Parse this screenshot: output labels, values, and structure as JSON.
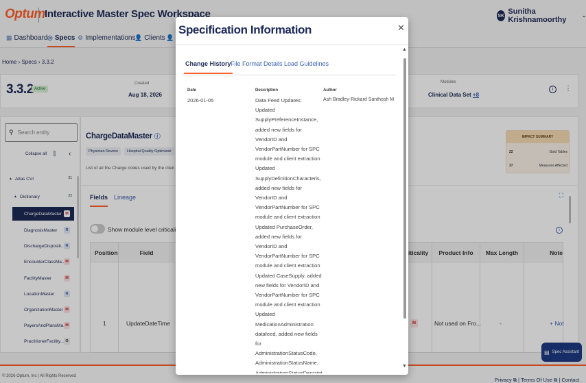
{
  "header": {
    "logo": "Optum",
    "app_title": "Interactive Master Spec Workspace",
    "user_initials": "SK",
    "user_name": "Sunitha Krishnamoorthy"
  },
  "nav": {
    "items": [
      {
        "label": "Dashboard",
        "icon": "dashboard-icon"
      },
      {
        "label": "Specs",
        "icon": "globe-icon"
      },
      {
        "label": "Implementations",
        "icon": "gear-icon"
      },
      {
        "label": "Clients",
        "icon": "person-icon"
      },
      {
        "label": "1",
        "icon": "person-icon"
      }
    ],
    "active": "Specs"
  },
  "breadcrumb": {
    "home": "Home",
    "specs": "Specs",
    "current": "3.3.2"
  },
  "spec": {
    "version": "3.3.2",
    "status": "Active",
    "created_label": "Created",
    "created_value": "Aug 18, 2026",
    "modules_label": "Modules",
    "modules_value": "Clinical Data Set",
    "modules_more": "+8"
  },
  "sidebar": {
    "search_placeholder": "Search entity",
    "collapse_label": "Collapse all",
    "tree": [
      {
        "label": "Atlas CVI",
        "count": "21",
        "level": 0
      },
      {
        "label": "Dictionary",
        "count": "22",
        "level": 1
      },
      {
        "label": "ChargeDataMaster",
        "tag": "M",
        "level": 2,
        "selected": true
      },
      {
        "label": "DiagnosisMaster",
        "tag": "R",
        "level": 2
      },
      {
        "label": "DischargeDispositi...",
        "tag": "R",
        "level": 2
      },
      {
        "label": "EncounterClassMa...",
        "tag": "M",
        "level": 2
      },
      {
        "label": "FacilityMaster",
        "tag": "M",
        "level": 2
      },
      {
        "label": "LocationMaster",
        "tag": "R",
        "level": 2
      },
      {
        "label": "OrganizationMaster",
        "tag": "M",
        "level": 2
      },
      {
        "label": "PayersAndPlansMa...",
        "tag": "M",
        "level": 2
      },
      {
        "label": "PractitionerFacility...",
        "tag": "O",
        "level": 2
      }
    ]
  },
  "entity": {
    "title": "ChargeDataMaster",
    "chips": [
      "Physician Review",
      "Hospital Quality Optimizati"
    ],
    "description": "List of all the Charge codes used by the clien",
    "impact_title": "IMPACT SUMMARY",
    "impact_rows": [
      {
        "count": "22",
        "label": "Gold Tables"
      },
      {
        "count": "37",
        "label": "Measures Affected"
      }
    ],
    "tabs": [
      "Fields",
      "Lineage"
    ],
    "toggle_label": "Show module level criticality"
  },
  "table": {
    "columns": [
      "Position",
      "Field",
      "iticality",
      "Product Info",
      "Max Length",
      "Note"
    ],
    "rows": [
      {
        "position": "1",
        "field": "UpdateDateTime",
        "criticality": "M",
        "product_info": "Not used on Fro...",
        "max_length": "-",
        "note": "+ Not"
      }
    ]
  },
  "footer": {
    "copyright": "© 2026 Optum, Inc | All Rights Reserved",
    "privacy": "Privacy",
    "terms": "Terms Of Use",
    "contact": "Contact Us"
  },
  "assistant": {
    "label": "Spec Assistant"
  },
  "modal": {
    "title": "Specification Information",
    "tabs": [
      "Change History",
      "File Format Details",
      "Load Guidelines"
    ],
    "active_tab": "Change History",
    "columns": {
      "date": "Date",
      "description": "Description",
      "author": "Author"
    },
    "entry": {
      "date": "2026-01-05",
      "description": "Data Feed Updates: Updated SupplyPreferenceInstance, added new fields for VendorID and VendorPartNumber for SPC module and client extraction Updated SupplyDefinitionCharacteris, added new fields for VendorID and VendorPartNumber for SPC module and client extraction Updated PurchaseOrder, added new fields for VendorID and VendorPartNumber for SPC module and client extraction Updated CaseSupply, added new fields for VendorID and VendorPartNumber for SPC module and client extraction Updated MedicationAdministration datafeed, added new fields for AdministrationStatusCode, AdministrationStatusName, AdministrationStatusDescription to replace AdministrationStatus to bring datafeed in line with current documentation and FHIR Criticality Updates: Updated SPC columns in",
      "author": "Ash Bradley-Rickard Santhosh M"
    }
  }
}
